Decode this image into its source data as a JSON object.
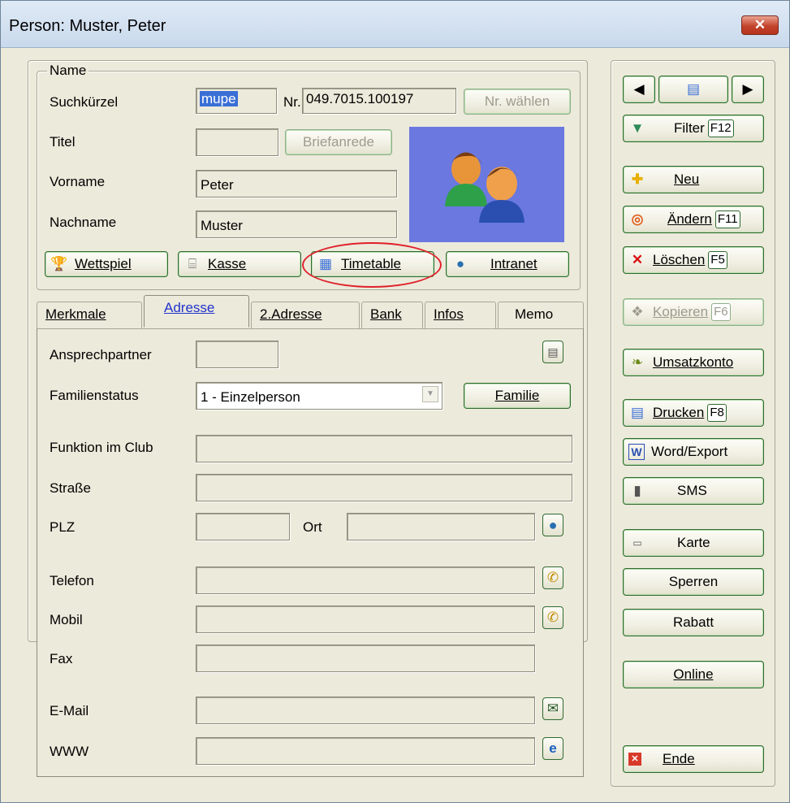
{
  "window": {
    "title": "Person: Muster, Peter",
    "close": "✕"
  },
  "name_group": {
    "legend": "Name",
    "suchkuerzel_label": "Suchkürzel",
    "suchkuerzel_value": "mupe",
    "nr_label": "Nr.",
    "nr_value": "049.7015.100197",
    "nr_waehlen": "Nr. wählen",
    "titel_label": "Titel",
    "titel_value": "",
    "briefanrede": "Briefanrede",
    "vorname_label": "Vorname",
    "vorname_value": "Peter",
    "nachname_label": "Nachname",
    "nachname_value": "Muster"
  },
  "quick_buttons": {
    "wettspiel": "Wettspiel",
    "kasse": "Kasse",
    "timetable": "Timetable",
    "intranet": "Intranet"
  },
  "tabs": [
    "Merkmale",
    "Adresse",
    "2.Adresse",
    "Bank",
    "Infos",
    "Memo"
  ],
  "address": {
    "ansprechpartner_label": "Ansprechpartner",
    "ansprechpartner_value": "",
    "familienstatus_label": "Familienstatus",
    "familienstatus_value": "1 - Einzelperson",
    "familie_button": "Familie",
    "funktion_label": "Funktion im Club",
    "strasse_label": "Straße",
    "plz_label": "PLZ",
    "ort_label": "Ort",
    "telefon_label": "Telefon",
    "mobil_label": "Mobil",
    "fax_label": "Fax",
    "email_label": "E-Mail",
    "www_label": "WWW"
  },
  "sidebar": {
    "filter": "Filter",
    "filter_key": "F12",
    "neu": "Neu",
    "aendern": "Ändern",
    "aendern_key": "F11",
    "loeschen": "Löschen",
    "loeschen_key": "F5",
    "kopieren": "Kopieren",
    "kopieren_key": "F6",
    "umsatzkonto": "Umsatzkonto",
    "drucken": "Drucken",
    "drucken_key": "F8",
    "word_export": "Word/Export",
    "sms": "SMS",
    "karte": "Karte",
    "sperren": "Sperren",
    "rabatt": "Rabatt",
    "online": "Online",
    "ende": "Ende"
  },
  "colors": {
    "accent_green": "#2f6a2f",
    "highlight_circle": "#e0202a",
    "tab_active_text": "#2233cc",
    "photo_bg": "#6a78e0"
  }
}
